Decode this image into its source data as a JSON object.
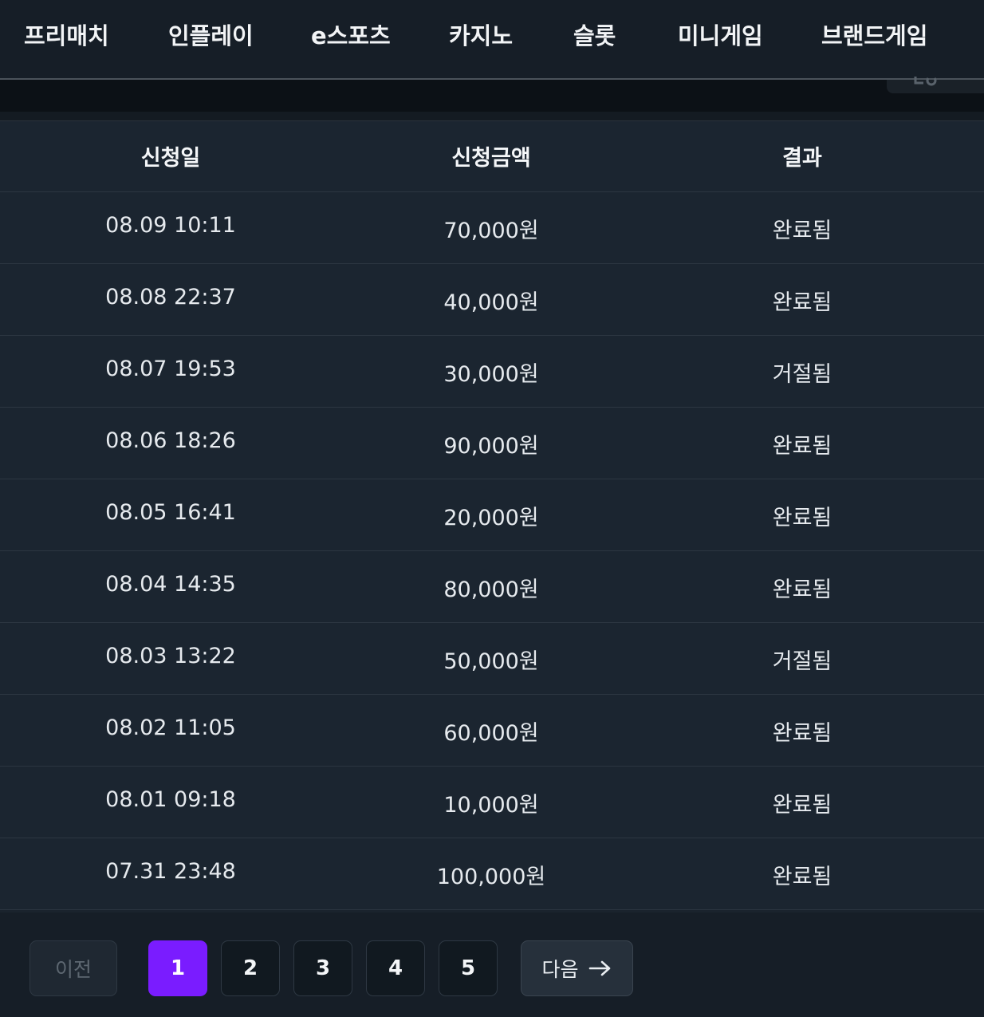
{
  "nav": {
    "items": [
      "프리매치",
      "인플레이",
      "e스포츠",
      "카지노",
      "슬롯",
      "미니게임",
      "브랜드게임"
    ]
  },
  "table": {
    "headers": [
      "신청일",
      "신청금액",
      "결과"
    ],
    "rows": [
      [
        "08.09 10:11",
        "70,000원",
        "완료됨"
      ],
      [
        "08.08 22:37",
        "40,000원",
        "완료됨"
      ],
      [
        "08.07 19:53",
        "30,000원",
        "거절됨"
      ],
      [
        "08.06 18:26",
        "90,000원",
        "완료됨"
      ],
      [
        "08.05 16:41",
        "20,000원",
        "완료됨"
      ],
      [
        "08.04 14:35",
        "80,000원",
        "완료됨"
      ],
      [
        "08.03 13:22",
        "50,000원",
        "거절됨"
      ],
      [
        "08.02 11:05",
        "60,000원",
        "완료됨"
      ],
      [
        "08.01 09:18",
        "10,000원",
        "완료됨"
      ],
      [
        "07.31 23:48",
        "100,000원",
        "완료됨"
      ]
    ]
  },
  "pagination": {
    "prev_label": "이전",
    "pages": [
      "1",
      "2",
      "3",
      "4",
      "5"
    ],
    "current_page": "1",
    "next_label": "다음",
    "next_icon": "arrow-right-icon"
  },
  "colors": {
    "accent": "#7a1cff",
    "background": "#1a232d"
  }
}
